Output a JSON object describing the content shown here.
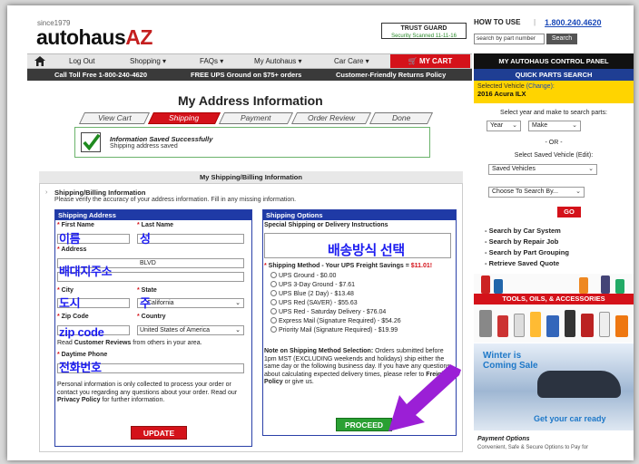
{
  "header": {
    "since": "since1979",
    "logo_main": "autohaus",
    "logo_accent": "AZ",
    "trust_title": "TRUST GUARD",
    "trust_sub": "Security Scanned 11-11-16",
    "how_to_use": "HOW TO USE",
    "separator": "|",
    "phone": "1.800.240.4620",
    "search_placeholder": "search by part number",
    "search_button": "Search"
  },
  "nav": {
    "items": [
      "Log Out",
      "Shopping ▾",
      "FAQs ▾",
      "My Autohaus ▾",
      "Car Care ▾"
    ],
    "cart": "MY CART",
    "control_panel": "MY AUTOHAUS CONTROL PANEL"
  },
  "subnav": {
    "items": [
      "Call Toll Free 1-800-240-4620",
      "FREE UPS Ground on $75+ orders",
      "Customer-Friendly Returns Policy"
    ],
    "quick_parts": "QUICK PARTS SEARCH"
  },
  "sidebar": {
    "selected_label": "Selected Vehicle",
    "change": "(Change):",
    "vehicle": "2016 Acura ILX",
    "instruction": "Select year and make to search parts:",
    "year": "Year",
    "make": "Make",
    "or": "- OR -",
    "saved_label": "Select Saved Vehicle (Edit):",
    "saved_select": "Saved Vehicles",
    "choose_select": "Choose To Search By...",
    "go": "GO",
    "links": [
      "- Search by Car System",
      "- Search by Repair Job",
      "- Search by Part Grouping",
      "- Retrieve Saved Quote"
    ],
    "tools_banner": "TOOLS, OILS, & ACCESSORIES",
    "winter_line1": "Winter is",
    "winter_line2": "Coming Sale",
    "winter_cta": "Get your car ready",
    "payment_title": "Payment Options",
    "payment_sub": "Convenient, Safe & Secure Options to Pay for"
  },
  "main": {
    "title": "My Address Information",
    "steps": [
      "View Cart",
      "Shipping",
      "Payment",
      "Order Review",
      "Done"
    ],
    "notice_title": "Information Saved Successfully",
    "notice_sub": "Shipping address saved",
    "panel_title": "My Shipping/Billing Information",
    "bi_heading": "Shipping/Billing Information",
    "bi_desc": "Please verify the accuracy of your address information. Fill in any missing information."
  },
  "shipping_address": {
    "head": "Shipping Address",
    "first_name": "First Name",
    "last_name": "Last Name",
    "address": "Address",
    "address_value": "BLVD",
    "city": "City",
    "state": "State",
    "state_value": "California",
    "zip": "Zip Code",
    "country": "Country",
    "country_value": "United States of America",
    "reviews_line_pre": "Read ",
    "reviews_link": "Customer Reviews",
    "reviews_line_post": " from others in your area.",
    "phone_label": "Daytime Phone",
    "privacy_text": "Personal information is only collected to process your order or contact you regarding any questions about your order. Read our ",
    "privacy_link": "Privacy Policy",
    "privacy_end": " for further information.",
    "update": "UPDATE"
  },
  "shipping_options": {
    "head": "Shipping Options",
    "special_label": "Special Shipping or Delivery Instructions",
    "method_label": "Shipping Method - Your UPS Freight Savings = ",
    "savings": "$11.01!",
    "options": [
      "UPS Ground - $0.00",
      "UPS 3-Day Ground - $7.61",
      "UPS Blue (2 Day) - $13.48",
      "UPS Red (SAVER) - $55.63",
      "UPS Red - Saturday Delivery - $76.04",
      "Express Mail (Signature Required) - $54.26",
      "Priority Mail (Signature Required) - $19.99"
    ],
    "note_title": "Note on Shipping Method Selection:",
    "note_text": " Orders submitted before 1pm MST (EXCLUDING weekends and holidays) ship either the same day or the following business day. If you have any questions about calculating expected delivery times, please refer to ",
    "note_link": "Freight Policy",
    "note_end": " or give us.",
    "proceed": "PROCEED"
  },
  "annotations": {
    "name": "이름",
    "surname": "성",
    "address": "배대지주소",
    "city": "도시",
    "state": "주",
    "zip": "zip code",
    "phone": "전화번호",
    "shipping": "배송방식 선택"
  },
  "colors": {
    "brand_red": "#d4121a",
    "nav_blue": "#1f3aa6",
    "link_blue": "#1a49b8",
    "proceed_green": "#2aa033",
    "annotation_blue": "#1c1cf0",
    "annotation_arrow": "#9b1fd6",
    "vehicle_yellow": "#ffd400"
  }
}
